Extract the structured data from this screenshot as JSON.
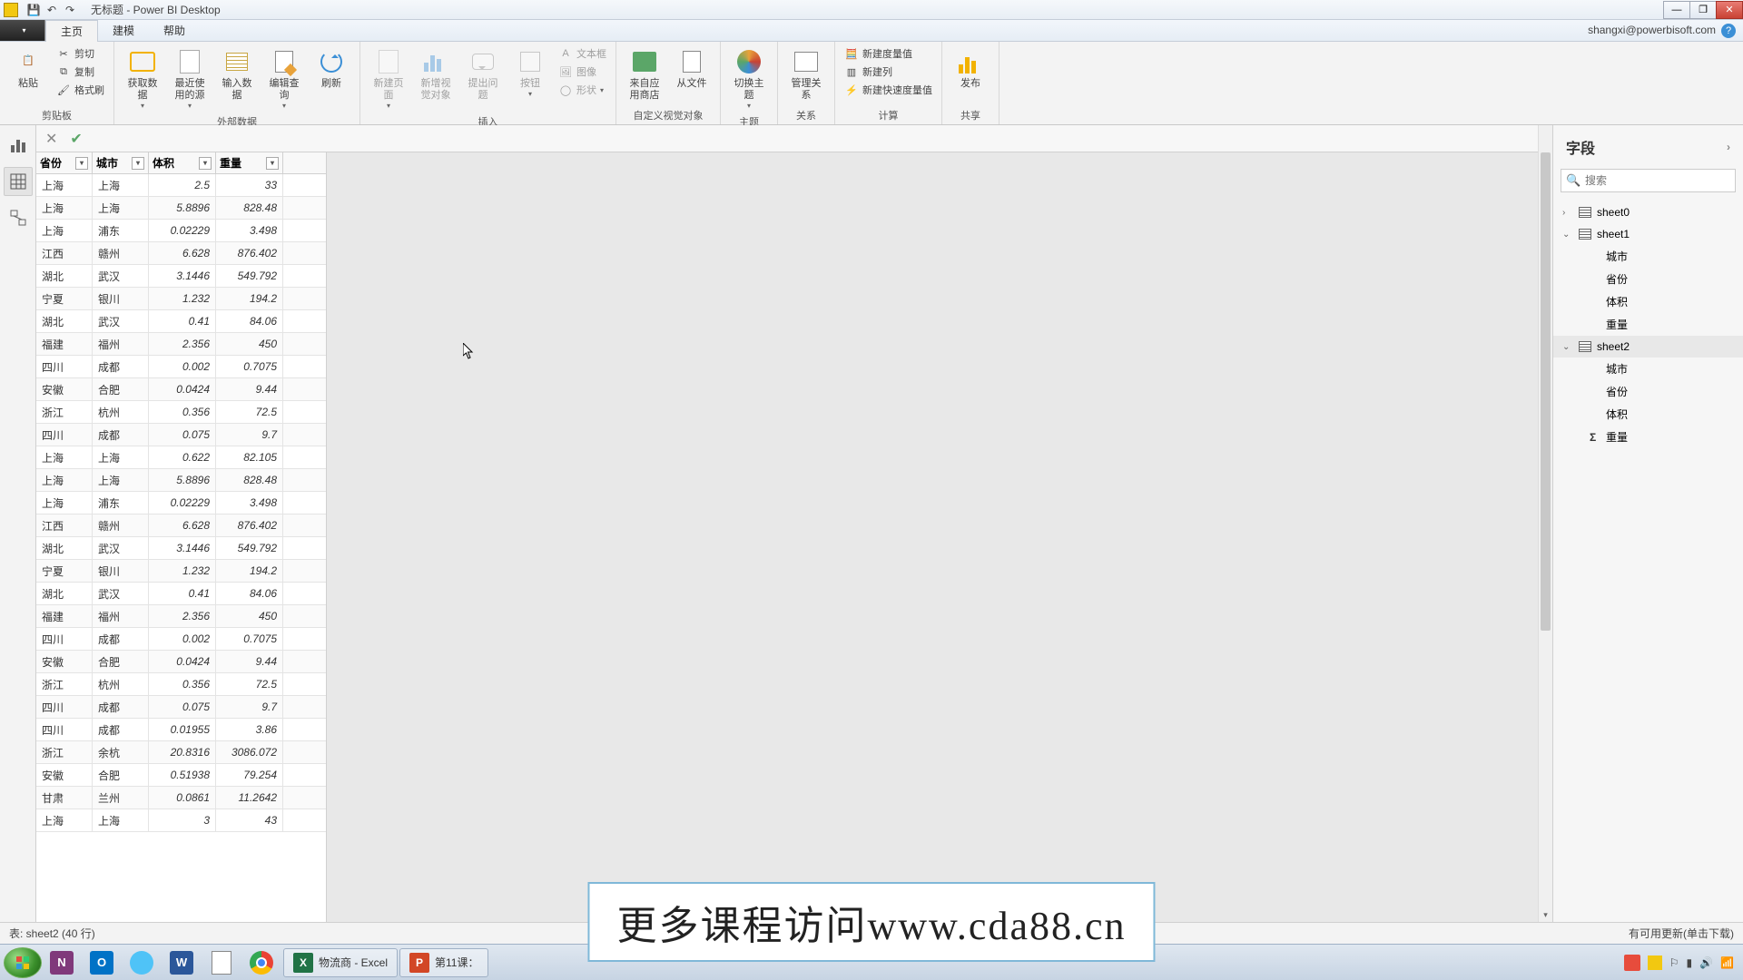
{
  "title": "无标题 - Power BI Desktop",
  "account": "shangxi@powerbisoft.com",
  "tabs": {
    "home": "主页",
    "model": "建模",
    "help": "帮助"
  },
  "ribbon": {
    "clipboard": {
      "paste": "粘贴",
      "cut": "剪切",
      "copy": "复制",
      "format": "格式刷",
      "group": "剪贴板"
    },
    "external": {
      "getdata": "获取数据",
      "recent": "最近使用的源",
      "enter": "输入数据",
      "edit": "编辑查询",
      "refresh": "刷新",
      "group": "外部数据"
    },
    "insert": {
      "page": "新建页面",
      "visual": "新增视觉对象",
      "ask": "提出问题",
      "buttons": "按钮",
      "textbox": "文本框",
      "image": "图像",
      "shapes": "形状",
      "group": "插入"
    },
    "custom": {
      "store": "来自应用商店",
      "file": "从文件",
      "group": "自定义视觉对象"
    },
    "theme": {
      "switch": "切换主题",
      "group": "主题"
    },
    "rel": {
      "manage": "管理关系",
      "group": "关系"
    },
    "calc": {
      "measure": "新建度量值",
      "column": "新建列",
      "quick": "新建快速度量值",
      "group": "计算"
    },
    "share": {
      "publish": "发布",
      "group": "共享"
    }
  },
  "grid": {
    "headers": [
      "省份",
      "城市",
      "体积",
      "重量"
    ],
    "rows": [
      [
        "上海",
        "上海",
        "2.5",
        "33"
      ],
      [
        "上海",
        "上海",
        "5.8896",
        "828.48"
      ],
      [
        "上海",
        "浦东",
        "0.02229",
        "3.498"
      ],
      [
        "江西",
        "赣州",
        "6.628",
        "876.402"
      ],
      [
        "湖北",
        "武汉",
        "3.1446",
        "549.792"
      ],
      [
        "宁夏",
        "银川",
        "1.232",
        "194.2"
      ],
      [
        "湖北",
        "武汉",
        "0.41",
        "84.06"
      ],
      [
        "福建",
        "福州",
        "2.356",
        "450"
      ],
      [
        "四川",
        "成都",
        "0.002",
        "0.7075"
      ],
      [
        "安徽",
        "合肥",
        "0.0424",
        "9.44"
      ],
      [
        "浙江",
        "杭州",
        "0.356",
        "72.5"
      ],
      [
        "四川",
        "成都",
        "0.075",
        "9.7"
      ],
      [
        "上海",
        "上海",
        "0.622",
        "82.105"
      ],
      [
        "上海",
        "上海",
        "5.8896",
        "828.48"
      ],
      [
        "上海",
        "浦东",
        "0.02229",
        "3.498"
      ],
      [
        "江西",
        "赣州",
        "6.628",
        "876.402"
      ],
      [
        "湖北",
        "武汉",
        "3.1446",
        "549.792"
      ],
      [
        "宁夏",
        "银川",
        "1.232",
        "194.2"
      ],
      [
        "湖北",
        "武汉",
        "0.41",
        "84.06"
      ],
      [
        "福建",
        "福州",
        "2.356",
        "450"
      ],
      [
        "四川",
        "成都",
        "0.002",
        "0.7075"
      ],
      [
        "安徽",
        "合肥",
        "0.0424",
        "9.44"
      ],
      [
        "浙江",
        "杭州",
        "0.356",
        "72.5"
      ],
      [
        "四川",
        "成都",
        "0.075",
        "9.7"
      ],
      [
        "四川",
        "成都",
        "0.01955",
        "3.86"
      ],
      [
        "浙江",
        "余杭",
        "20.8316",
        "3086.072"
      ],
      [
        "安徽",
        "合肥",
        "0.51938",
        "79.254"
      ],
      [
        "甘肃",
        "兰州",
        "0.0861",
        "11.2642"
      ],
      [
        "上海",
        "上海",
        "3",
        "43"
      ]
    ]
  },
  "fields": {
    "title": "字段",
    "search_ph": "搜索",
    "tables": [
      {
        "name": "sheet0",
        "open": false,
        "cols": []
      },
      {
        "name": "sheet1",
        "open": true,
        "cols": [
          {
            "n": "城市",
            "sum": false
          },
          {
            "n": "省份",
            "sum": false
          },
          {
            "n": "体积",
            "sum": false
          },
          {
            "n": "重量",
            "sum": false
          }
        ]
      },
      {
        "name": "sheet2",
        "open": true,
        "sel": true,
        "cols": [
          {
            "n": "城市",
            "sum": false
          },
          {
            "n": "省份",
            "sum": false
          },
          {
            "n": "体积",
            "sum": false
          },
          {
            "n": "重量",
            "sum": true
          }
        ]
      }
    ]
  },
  "status": {
    "left": "表: sheet2 (40 行)",
    "right": "有可用更新(单击下载)"
  },
  "taskbar": {
    "apps": [
      {
        "label": "物流商 - Excel"
      },
      {
        "label": "第11课："
      }
    ]
  },
  "watermark": "更多课程访问www.cda88.cn"
}
